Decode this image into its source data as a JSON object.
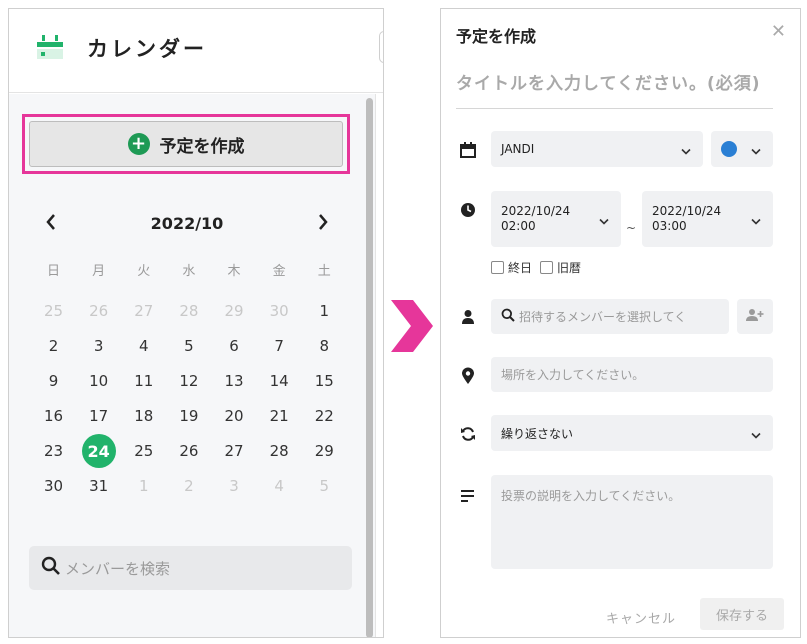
{
  "colors": {
    "accent_green": "#21b36b",
    "highlight_pink": "#e6369a",
    "event_color": "#2a7fd4"
  },
  "calendar_panel": {
    "title": "カレンダー",
    "create_button_label": "予定を作成",
    "month_label": "2022/10",
    "prev_icon": "chevron-left-icon",
    "next_icon": "chevron-right-icon",
    "weekdays": [
      "日",
      "月",
      "火",
      "水",
      "木",
      "金",
      "土"
    ],
    "weeks": [
      [
        "25",
        "26",
        "27",
        "28",
        "29",
        "30",
        "1"
      ],
      [
        "2",
        "3",
        "4",
        "5",
        "6",
        "7",
        "8"
      ],
      [
        "9",
        "10",
        "11",
        "12",
        "13",
        "14",
        "15"
      ],
      [
        "16",
        "17",
        "18",
        "19",
        "20",
        "21",
        "22"
      ],
      [
        "23",
        "24",
        "25",
        "26",
        "27",
        "28",
        "29"
      ],
      [
        "30",
        "31",
        "1",
        "2",
        "3",
        "4",
        "5"
      ]
    ],
    "today": "24",
    "member_search_placeholder": "メンバーを検索"
  },
  "create_event_modal": {
    "title": "予定を作成",
    "close_icon": "close-icon",
    "title_placeholder": "タイトルを入力してください。(必須)",
    "calendar_select_value": "JANDI",
    "start_date": "2022/10/24",
    "start_time": "02:00",
    "end_date": "2022/10/24",
    "end_time": "03:00",
    "range_separator": "~",
    "all_day_label": "終日",
    "lunar_label": "旧暦",
    "invite_placeholder": "招待するメンバーを選択してく",
    "location_placeholder": "場所を入力してください。",
    "repeat_value": "繰り返さない",
    "description_placeholder": "投票の説明を入力してください。",
    "cancel_label": "キャンセル",
    "save_label": "保存する"
  }
}
